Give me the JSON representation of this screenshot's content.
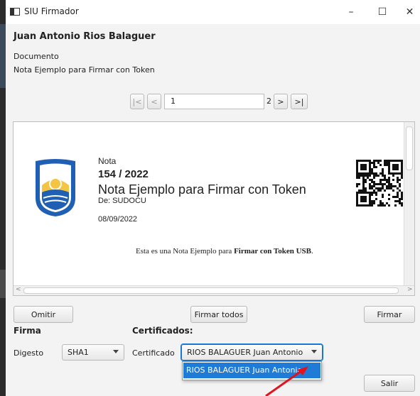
{
  "window": {
    "title": "SIU Firmador",
    "min": "–",
    "max": "☐",
    "close": "✕"
  },
  "signer": "Juan Antonio Rios Balaguer",
  "document": {
    "label": "Documento",
    "name": "Nota Ejemplo para Firmar con Token"
  },
  "pager": {
    "first": "|<",
    "prev": "<",
    "page": "1",
    "total": "2",
    "next": ">",
    "last": ">|"
  },
  "doc_content": {
    "type_label": "Nota",
    "number": "154 / 2022",
    "title": "Nota Ejemplo para Firmar con Token",
    "from": "De: SUDOCU",
    "date": "08/09/2022",
    "body_prefix": "Esta es una Nota Ejemplo para ",
    "body_bold": "Firmar con Token USB",
    "body_suffix": "."
  },
  "buttons": {
    "omitir": "Omitir",
    "firmar_todos": "Firmar todos",
    "firmar": "Firmar",
    "salir": "Salir"
  },
  "firma": {
    "heading": "Firma",
    "digest_label": "Digesto",
    "digest_value": "SHA1"
  },
  "certificados": {
    "heading": "Certificados:",
    "label": "Certificado",
    "selected": "RIOS BALAGUER Juan Antonio",
    "options": [
      "RIOS BALAGUER Juan Antonio"
    ]
  },
  "colors": {
    "accent": "#1976d2",
    "dropdown_highlight": "#1f7bd6",
    "annotation_arrow": "#e0141e",
    "shield_blue": "#1f5fb4",
    "shield_yellow": "#f4c542"
  }
}
